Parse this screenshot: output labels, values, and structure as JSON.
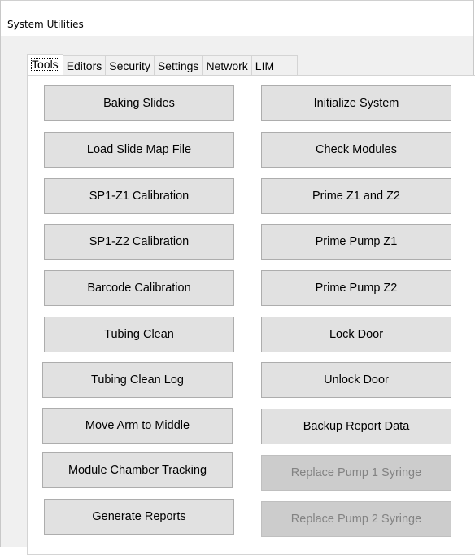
{
  "window": {
    "title": "System Utilities"
  },
  "tabs": [
    {
      "label": "Tools",
      "active": true
    },
    {
      "label": "Editors",
      "active": false
    },
    {
      "label": "Security",
      "active": false
    },
    {
      "label": "Settings",
      "active": false
    },
    {
      "label": "Network",
      "active": false
    },
    {
      "label": "LIM",
      "active": false
    }
  ],
  "tools": {
    "left_column": [
      {
        "label": "Baking Slides",
        "enabled": true
      },
      {
        "label": "Load Slide Map File",
        "enabled": true
      },
      {
        "label": "SP1-Z1 Calibration",
        "enabled": true
      },
      {
        "label": "SP1-Z2 Calibration",
        "enabled": true
      },
      {
        "label": "Barcode Calibration",
        "enabled": true
      },
      {
        "label": "Tubing Clean",
        "enabled": true
      },
      {
        "label": "Tubing Clean Log",
        "enabled": true
      },
      {
        "label": "Move Arm to Middle",
        "enabled": true
      },
      {
        "label": "Module Chamber Tracking",
        "enabled": true
      },
      {
        "label": "Generate Reports",
        "enabled": true
      }
    ],
    "right_column": [
      {
        "label": "Initialize System",
        "enabled": true
      },
      {
        "label": "Check Modules",
        "enabled": true
      },
      {
        "label": "Prime Z1 and Z2",
        "enabled": true
      },
      {
        "label": "Prime Pump Z1",
        "enabled": true
      },
      {
        "label": "Prime Pump Z2",
        "enabled": true
      },
      {
        "label": "Lock Door",
        "enabled": true
      },
      {
        "label": "Unlock Door",
        "enabled": true
      },
      {
        "label": "Backup Report Data",
        "enabled": true
      },
      {
        "label": "Replace Pump 1 Syringe",
        "enabled": false
      },
      {
        "label": "Replace Pump 2 Syringe",
        "enabled": false
      }
    ]
  }
}
